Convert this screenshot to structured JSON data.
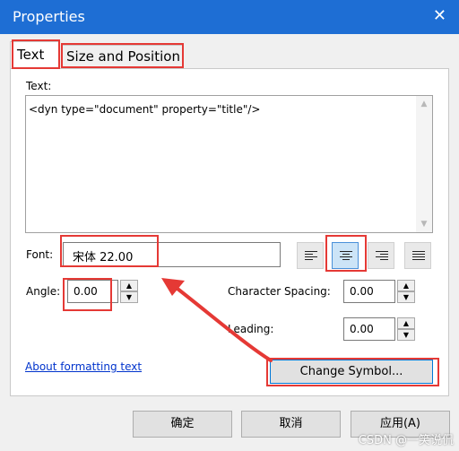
{
  "window": {
    "title": "Properties",
    "close_glyph": "✕"
  },
  "tabs": [
    {
      "label": "Text"
    },
    {
      "label": "Size and Position"
    }
  ],
  "text_section": {
    "label": "Text:",
    "content": "<dyn type=\"document\" property=\"title\"/>"
  },
  "font": {
    "label": "Font:",
    "value": "宋体 22.00"
  },
  "alignment": {
    "options": [
      "left",
      "center",
      "right",
      "justify"
    ],
    "selected": "center"
  },
  "angle": {
    "label": "Angle:",
    "value": "0.00"
  },
  "character_spacing": {
    "label": "Character Spacing:",
    "value": "0.00"
  },
  "leading": {
    "label": "Leading:",
    "value": "0.00"
  },
  "link": {
    "label": "About formatting text"
  },
  "buttons": {
    "change_symbol": "Change Symbol...",
    "ok": "确定",
    "cancel": "取消",
    "apply": "应用(A)"
  },
  "watermark": "CSDN @一笑说侃",
  "colors": {
    "titlebar": "#1e6ed4",
    "highlight": "#e53935",
    "selected_align": "#cce4f7",
    "link": "#0033cc"
  }
}
